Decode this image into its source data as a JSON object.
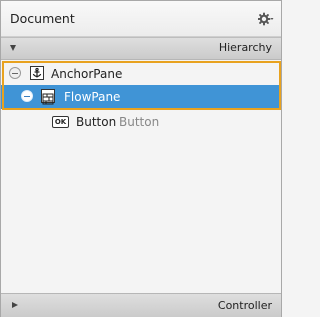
{
  "document": {
    "title": "Document",
    "gear_icon": "gear-icon"
  },
  "hierarchy": {
    "label": "Hierarchy",
    "expanded": true
  },
  "tree": {
    "nodes": [
      {
        "label": "AnchorPane",
        "sublabel": "",
        "icon": "anchor-icon",
        "selected": false,
        "highlighted": true
      },
      {
        "label": "FlowPane",
        "sublabel": "",
        "icon": "flowpane-icon",
        "selected": true,
        "highlighted": true
      },
      {
        "label": "Button",
        "sublabel": "Button",
        "icon": "ok-button-icon",
        "icon_text": "OK",
        "selected": false,
        "highlighted": false
      }
    ]
  },
  "controller": {
    "label": "Controller",
    "expanded": false
  },
  "colors": {
    "selection": "#4094d6",
    "outline": "#e8a21f"
  }
}
